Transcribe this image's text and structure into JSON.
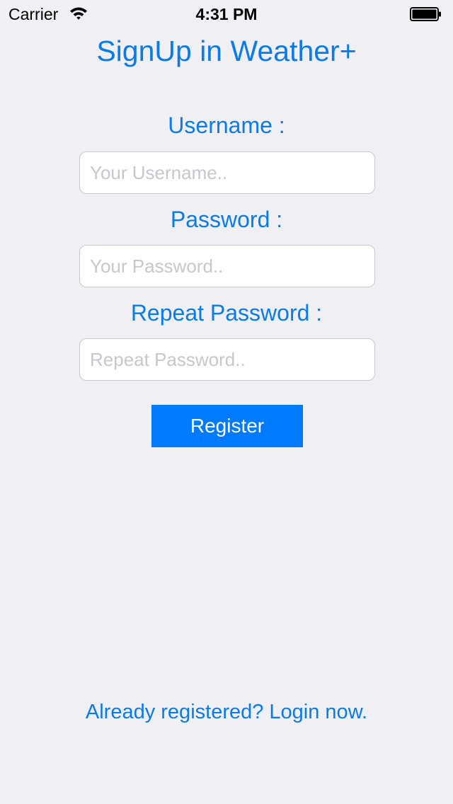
{
  "status_bar": {
    "carrier": "Carrier",
    "time": "4:31 PM",
    "icons": [
      "wifi-icon",
      "battery-icon"
    ]
  },
  "title": "SignUp in Weather+",
  "form": {
    "username": {
      "label": "Username :",
      "placeholder": "Your Username..",
      "value": ""
    },
    "password": {
      "label": "Password :",
      "placeholder": "Your Password..",
      "value": ""
    },
    "repeat_password": {
      "label": "Repeat Password :",
      "placeholder": "Repeat Password..",
      "value": ""
    },
    "register_label": "Register"
  },
  "login_link": "Already registered? Login now.",
  "colors": {
    "accent": "#007aff",
    "label_text": "#0a7bea",
    "background": "#efeff4",
    "placeholder": "#c7c7cd"
  }
}
